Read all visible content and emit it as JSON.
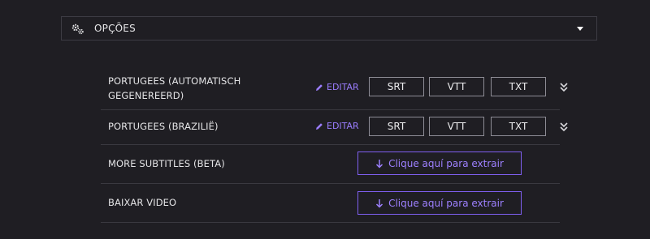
{
  "options": {
    "title": "OPÇÕES",
    "icon": "gears-icon",
    "toggle_icon": "caret-down-icon"
  },
  "subtitle_rows": [
    {
      "label_line1": "PORTUGEES (AUTOMATISCH",
      "label_line2": "GEGENEREERD)",
      "edit_label": "EDITAR",
      "formats": [
        "SRT",
        "VTT",
        "TXT"
      ]
    },
    {
      "label_line1": "PORTUGEES (BRAZILIË)",
      "edit_label": "EDITAR",
      "formats": [
        "SRT",
        "VTT",
        "TXT"
      ]
    }
  ],
  "extract_rows": [
    {
      "label": "MORE SUBTITLES (BETA)",
      "button_label": "Clique aquí para extrair"
    },
    {
      "label": "BAIXAR VIDEO",
      "button_label": "Clique aquí para extrair"
    }
  ],
  "colors": {
    "background": "#1f1e23",
    "accent": "#9b7dff",
    "border": "#3a3940"
  }
}
